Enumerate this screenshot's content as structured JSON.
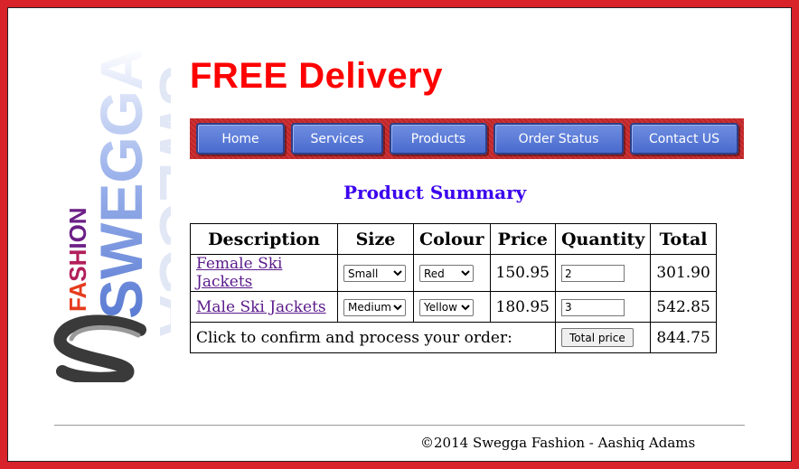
{
  "brand": {
    "name": "Swegga Fashion",
    "logo_text_main": "SWEGGA",
    "logo_text_sub": "FASHION"
  },
  "header": {
    "headline": "FREE Delivery"
  },
  "nav": {
    "items": [
      {
        "label": "Home"
      },
      {
        "label": "Services"
      },
      {
        "label": "Products"
      },
      {
        "label": "Order Status"
      },
      {
        "label": "Contact US"
      }
    ]
  },
  "summary": {
    "title": "Product Summary",
    "columns": [
      "Description",
      "Size",
      "Colour",
      "Price",
      "Quantity",
      "Total"
    ],
    "rows": [
      {
        "description": "Female Ski Jackets",
        "size": "Small",
        "colour": "Red",
        "price": "150.95",
        "quantity": "2",
        "total": "301.90"
      },
      {
        "description": "Male Ski Jackets",
        "size": "Medium",
        "colour": "Yellow",
        "price": "180.95",
        "quantity": "3",
        "total": "542.85"
      }
    ],
    "confirm_text": "Click to confirm and process your order:",
    "total_button_label": "Total price",
    "grand_total": "844.75"
  },
  "footer": {
    "text": "©2014 Swegga Fashion - Aashiq Adams"
  },
  "colors": {
    "frame": "#d9232b",
    "headline": "#ff0000",
    "nav_bar": "#c9282b",
    "nav_button": "#5b7bd8",
    "title": "#3a00ee",
    "link": "#5b1a8b"
  }
}
